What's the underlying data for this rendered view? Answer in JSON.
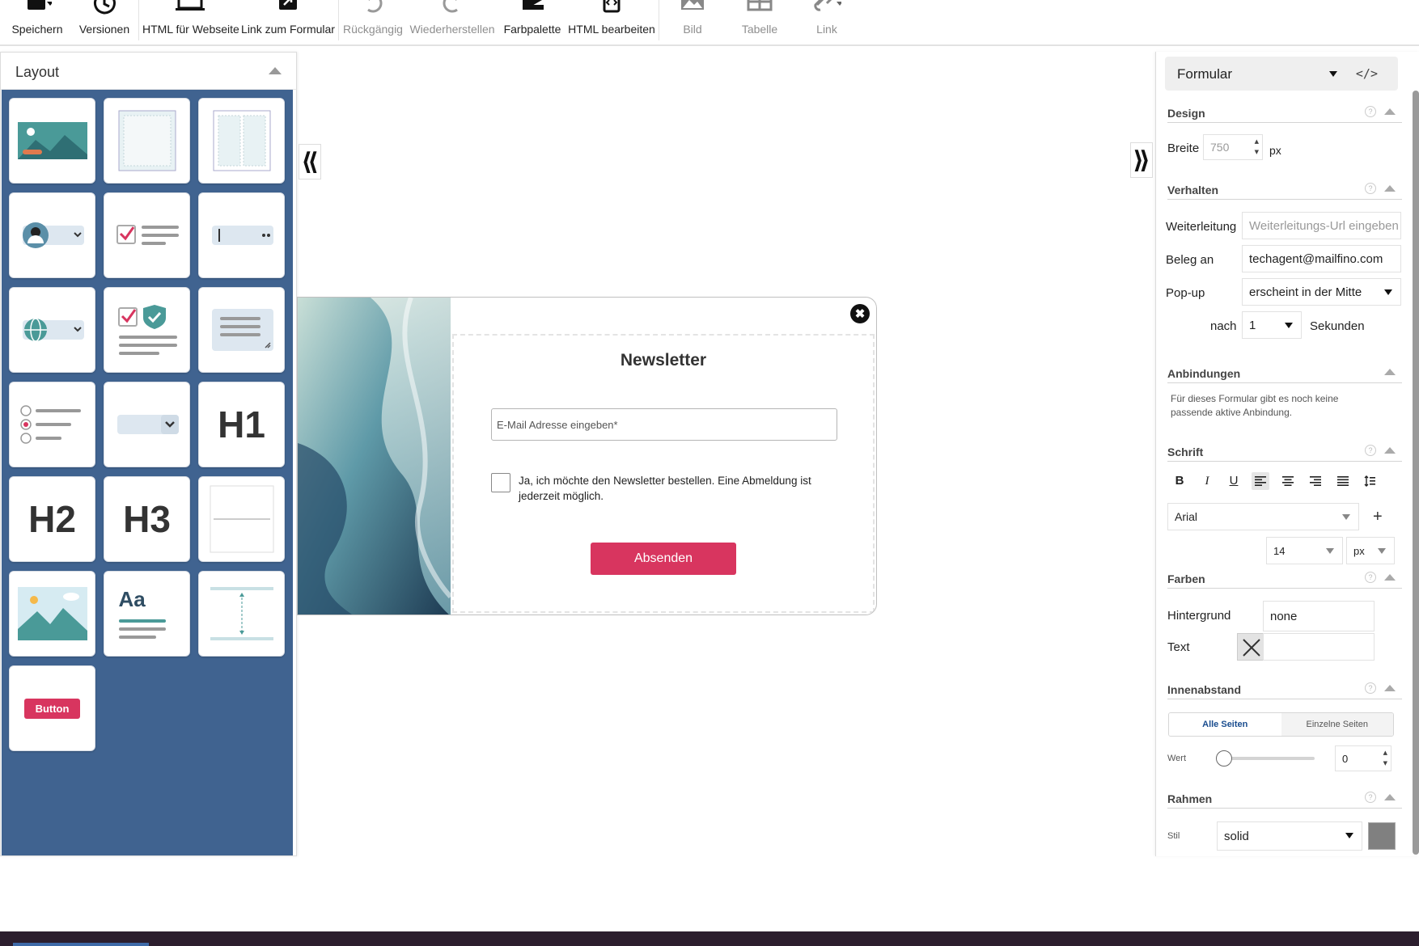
{
  "toolbar": {
    "save": "Speichern",
    "versions": "Versionen",
    "html_webpage": "HTML für Webseite",
    "link_form": "Link zum Formular",
    "undo": "Rückgängig",
    "redo": "Wiederherstellen",
    "palette": "Farbpalette",
    "edit_html": "HTML bearbeiten",
    "image": "Bild",
    "table": "Tabelle",
    "link": "Link"
  },
  "left_panel": {
    "title": "Layout",
    "tiles": [
      {
        "name": "image-banner-block"
      },
      {
        "name": "single-column-block"
      },
      {
        "name": "two-column-block"
      },
      {
        "name": "salutation-select-block"
      },
      {
        "name": "checkbox-text-block"
      },
      {
        "name": "password-field-block"
      },
      {
        "name": "language-select-block"
      },
      {
        "name": "privacy-consent-block"
      },
      {
        "name": "textarea-block"
      },
      {
        "name": "radio-group-block"
      },
      {
        "name": "dropdown-block"
      },
      {
        "name": "h1-block",
        "label": "H1"
      },
      {
        "name": "h2-block",
        "label": "H2"
      },
      {
        "name": "h3-block",
        "label": "H3"
      },
      {
        "name": "divider-block"
      },
      {
        "name": "image-block"
      },
      {
        "name": "text-block",
        "label": "Aa"
      },
      {
        "name": "spacer-block"
      },
      {
        "name": "button-block",
        "label": "Button"
      }
    ]
  },
  "form": {
    "title": "Newsletter",
    "email_placeholder": "E-Mail Adresse eingeben*",
    "checkbox_text": "Ja, ich möchte den Newsletter bestellen. Eine Abmeldung ist jederzeit möglich.",
    "submit": "Absenden",
    "close": "✖"
  },
  "right_panel": {
    "element_select": "Formular",
    "code_icon": "</>",
    "design": {
      "title": "Design",
      "width_label": "Breite",
      "width_value": "750",
      "unit": "px"
    },
    "behavior": {
      "title": "Verhalten",
      "redirect_label": "Weiterleitung",
      "redirect_placeholder": "Weiterleitungs-Url eingeben",
      "receipt_label": "Beleg an",
      "receipt_value": "techagent@mailfino.com",
      "popup_label": "Pop-up",
      "popup_value": "erscheint in der Mitte",
      "after_label": "nach",
      "after_value": "1",
      "seconds_label": "Sekunden"
    },
    "bindings": {
      "title": "Anbindungen",
      "text": "Für dieses Formular gibt es noch keine passende aktive Anbindung."
    },
    "font": {
      "title": "Schrift",
      "bold": "B",
      "italic": "I",
      "underline": "U",
      "family": "Arial",
      "add": "+",
      "size": "14",
      "size_unit": "px"
    },
    "colors": {
      "title": "Farben",
      "background_label": "Hintergrund",
      "background_value": "none",
      "text_label": "Text",
      "text_value": ""
    },
    "padding": {
      "title": "Innenabstand",
      "tab_all": "Alle Seiten",
      "tab_single": "Einzelne Seiten",
      "value_label": "Wert",
      "value": "0",
      "slider_fraction": 0
    },
    "border": {
      "title": "Rahmen",
      "style_label": "Stil",
      "style_value": "solid",
      "color": "#808080"
    }
  },
  "colors": {
    "accent": "#d8355f",
    "layout_panel_bg": "#406390"
  }
}
